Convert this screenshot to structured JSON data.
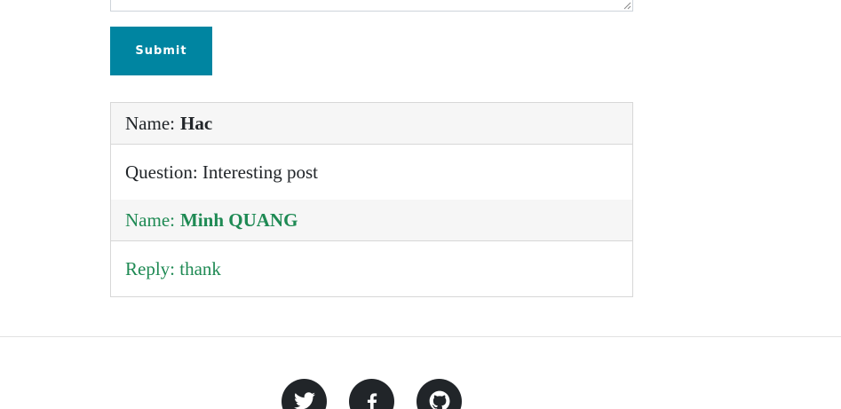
{
  "form": {
    "submit_label": "Submit"
  },
  "comments": [
    {
      "name_label": "Name:",
      "name": "Hac",
      "body_label": "Question:",
      "body": "Interesting post"
    },
    {
      "name_label": "Name:",
      "name": "Minh QUANG",
      "body_label": "Reply:",
      "body": "thank"
    }
  ],
  "colors": {
    "accent": "#0085a1",
    "reply": "#1f8a54",
    "text": "#212529"
  },
  "footer": {
    "social_icons": [
      "twitter-icon",
      "facebook-icon",
      "github-icon"
    ]
  }
}
